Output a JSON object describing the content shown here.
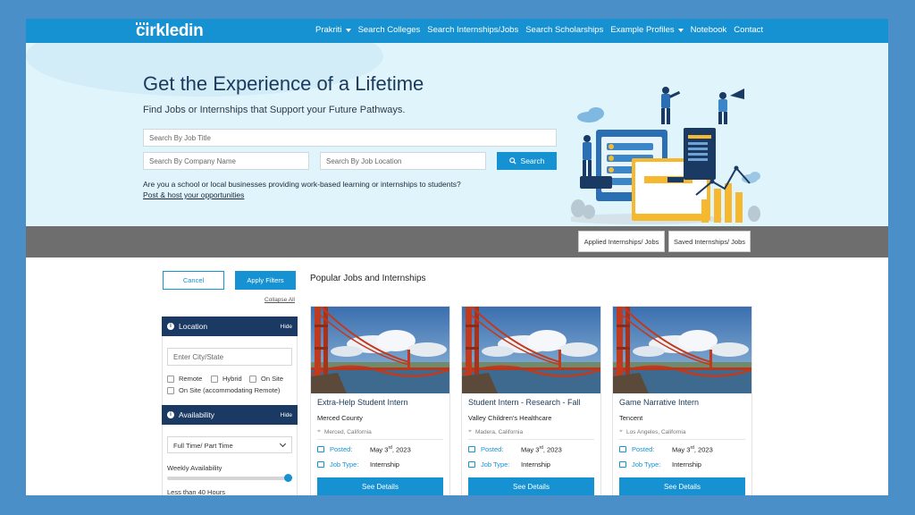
{
  "nav": {
    "logo": "cirkledin",
    "links": [
      {
        "label": "Prakriti",
        "dropdown": true
      },
      {
        "label": "Search Colleges",
        "dropdown": false
      },
      {
        "label": "Search Internships/Jobs",
        "dropdown": false
      },
      {
        "label": "Search Scholarships",
        "dropdown": false
      },
      {
        "label": "Example Profiles",
        "dropdown": true
      },
      {
        "label": "Notebook",
        "dropdown": false
      },
      {
        "label": "Contact",
        "dropdown": false
      }
    ]
  },
  "hero": {
    "title": "Get the Experience of a Lifetime",
    "subtitle": "Find Jobs or Internships that Support your Future Pathways.",
    "job_title_placeholder": "Search By Job Title",
    "company_placeholder": "Search By Company Name",
    "location_placeholder": "Search By Job Location",
    "search_label": "Search",
    "question": "Are you a school or local businesses providing work-based learning or internships to students?",
    "post_link": "Post & host your opportunities"
  },
  "actions": {
    "applied": "Applied Internships/ Jobs",
    "saved": "Saved Internships/ Jobs"
  },
  "filters": {
    "cancel": "Cancel",
    "apply": "Apply Filters",
    "collapse_all": "Collapse All",
    "location": {
      "title": "Location",
      "hide": "Hide",
      "city_placeholder": "Enter City/State",
      "options": [
        "Remote",
        "Hybrid",
        "On Site",
        "On Site (accommodating Remote)"
      ]
    },
    "availability": {
      "title": "Availability",
      "hide": "Hide",
      "selected": "Full Time/ Part Time",
      "weekly_label": "Weekly Availability",
      "hours_label": "Less than 40 Hours",
      "slider_value": 1.0
    }
  },
  "popular": {
    "title": "Popular Jobs and Internships",
    "cards": [
      {
        "title": "Extra-Help Student Intern",
        "company": "Merced County",
        "location": "Merced, California",
        "posted_label": "Posted:",
        "posted_pre": "May 3",
        "posted_sup": "rd",
        "posted_post": ", 2023",
        "type_label": "Job Type:",
        "type": "Internship",
        "button": "See Details"
      },
      {
        "title": "Student Intern - Research - Fall",
        "company": "Valley Children's Healthcare",
        "location": "Madera, California",
        "posted_label": "Posted:",
        "posted_pre": "May 3",
        "posted_sup": "rd",
        "posted_post": ", 2023",
        "type_label": "Job Type:",
        "type": "Internship",
        "button": "See Details"
      },
      {
        "title": "Game Narrative Intern",
        "company": "Tencent",
        "location": "Los Angeles, California",
        "posted_label": "Posted:",
        "posted_pre": "May 3",
        "posted_sup": "rd",
        "posted_post": ", 2023",
        "type_label": "Job Type:",
        "type": "Internship",
        "button": "See Details"
      }
    ]
  },
  "colors": {
    "brand": "#1691d1",
    "navy": "#1b3a63",
    "hero_bg": "#e0f4fb",
    "gray_bar": "#6e6e6e"
  }
}
